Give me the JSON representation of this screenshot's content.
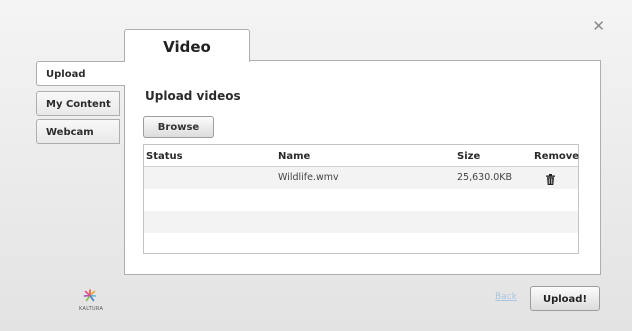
{
  "close_icon": "close-icon",
  "tabs": {
    "video": "Video"
  },
  "sidebar": {
    "items": [
      {
        "label": "Upload",
        "active": true
      },
      {
        "label": "My Content",
        "active": false
      },
      {
        "label": "Webcam",
        "active": false
      }
    ]
  },
  "main": {
    "title": "Upload videos",
    "browse_label": "Browse",
    "table": {
      "headers": {
        "status": "Status",
        "name": "Name",
        "size": "Size",
        "remove": "Remove"
      },
      "rows": [
        {
          "status": "",
          "name": "Wildlife.wmv",
          "size": "25,630.0KB",
          "remove_icon": "trash-icon"
        }
      ]
    }
  },
  "footer": {
    "logo_text": "KALTURA",
    "back_label": "Back",
    "upload_label": "Upload!"
  },
  "colors": {
    "link_disabled": "#a9c6e2",
    "border": "#aeaeae"
  }
}
